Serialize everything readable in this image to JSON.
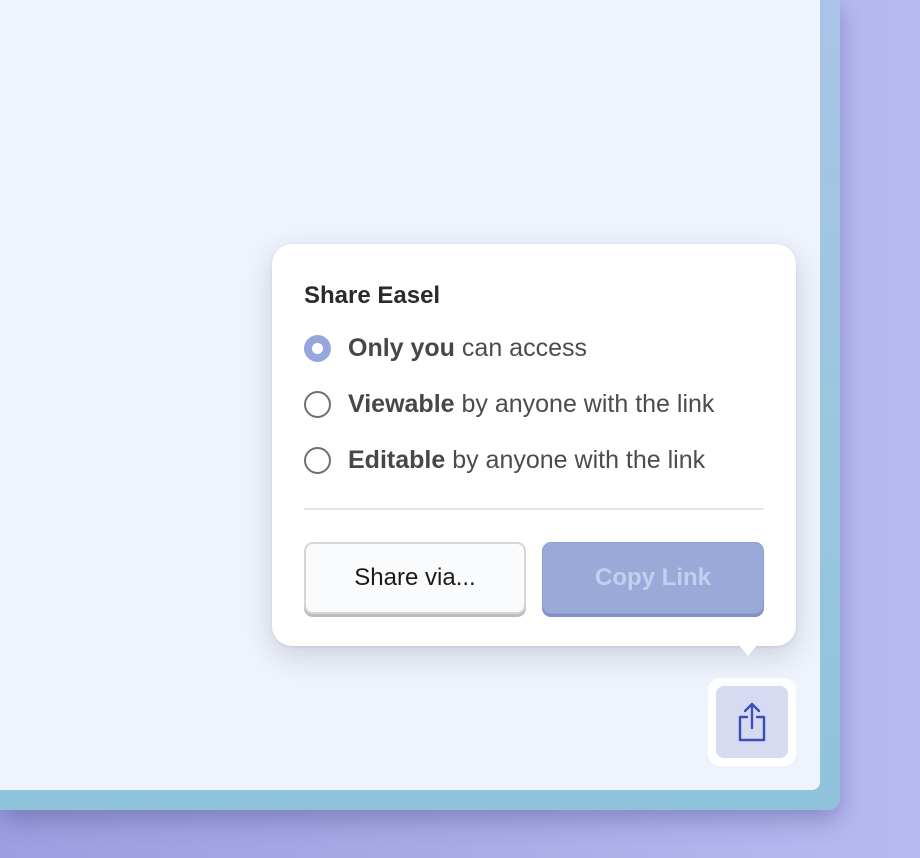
{
  "share_popover": {
    "title": "Share Easel",
    "options": [
      {
        "bold": "Only you",
        "rest": " can access",
        "selected": true
      },
      {
        "bold": "Viewable",
        "rest": " by anyone with the link",
        "selected": false
      },
      {
        "bold": "Editable",
        "rest": " by anyone with the link",
        "selected": false
      }
    ],
    "buttons": {
      "share_via": "Share via...",
      "copy_link": "Copy Link"
    }
  },
  "share_toolbar_button": {
    "icon": "share-icon"
  },
  "colors": {
    "accent": "#96a8db",
    "copy_link_disabled_bg": "#99aad9",
    "share_button_bg": "#d6dbf2",
    "share_icon": "#3a4fb8"
  }
}
